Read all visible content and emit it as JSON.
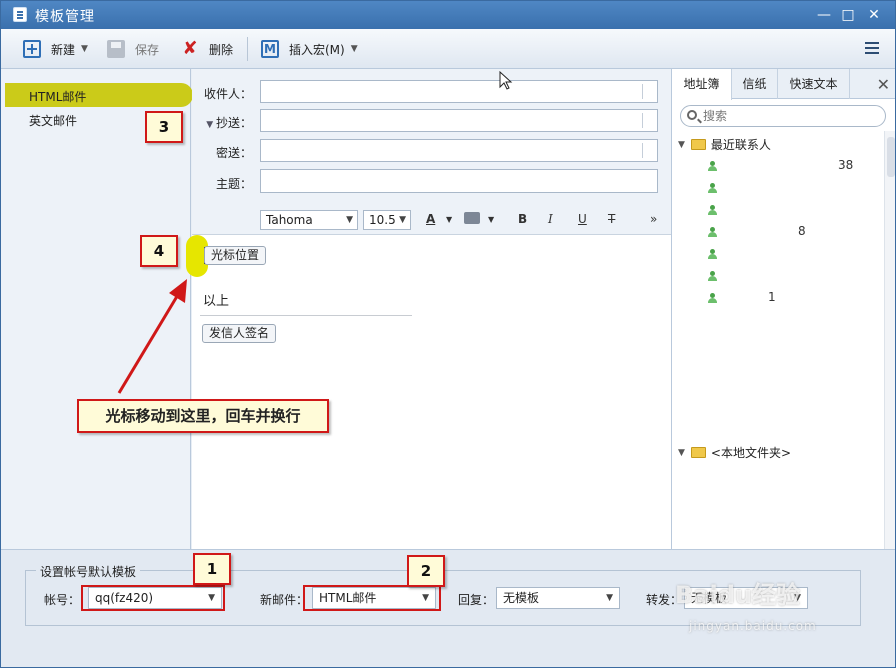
{
  "window": {
    "title": "模板管理",
    "controls": [
      "—",
      "□",
      "✕"
    ]
  },
  "toolbar": {
    "new_label": "新建",
    "save_label": "保存",
    "delete_label": "删除",
    "macro_label": "插入宏(M)"
  },
  "templates": {
    "items": [
      {
        "label": "HTML邮件"
      },
      {
        "label": "英文邮件"
      }
    ]
  },
  "fields": {
    "to_label": "收件人：",
    "cc_label": "抄送：",
    "bcc_label": "密送：",
    "subject_label": "主题："
  },
  "format": {
    "font": "Tahoma",
    "size": "10.5",
    "bold": "B",
    "italic": "I",
    "underline": "U",
    "strike": "T",
    "more": "»"
  },
  "editor": {
    "cursor_chip": "光标位置",
    "body_text": "以上",
    "signature_chip": "发信人签名"
  },
  "right_panel": {
    "tabs": [
      "地址簿",
      "信纸",
      "快速文本"
    ],
    "search_placeholder": "搜索",
    "groups": [
      {
        "label": "最近联系人"
      },
      {
        "label": "<本地文件夹>"
      }
    ],
    "fragments": [
      "38",
      "1",
      "8",
      "1"
    ]
  },
  "bottom": {
    "group_title": "设置帐号默认模板",
    "account_label": "帐号：",
    "account_value": "qq(fz420)",
    "newmail_label": "新邮件：",
    "newmail_value": "HTML邮件",
    "reply_label": "回复：",
    "reply_value": "无模板",
    "forward_label": "转发：",
    "forward_value": "无模板"
  },
  "annotations": {
    "badges": [
      "1",
      "2",
      "3",
      "4"
    ],
    "callout": "光标移动到这里，回车并换行"
  },
  "watermark": {
    "brand": "Baidu经验",
    "url": "jingyan.baidu.com"
  },
  "colors": {
    "annotation_red": "#d01818",
    "highlight_yellow": "#e6e600",
    "titlebar_blue": "#3a70ad"
  }
}
